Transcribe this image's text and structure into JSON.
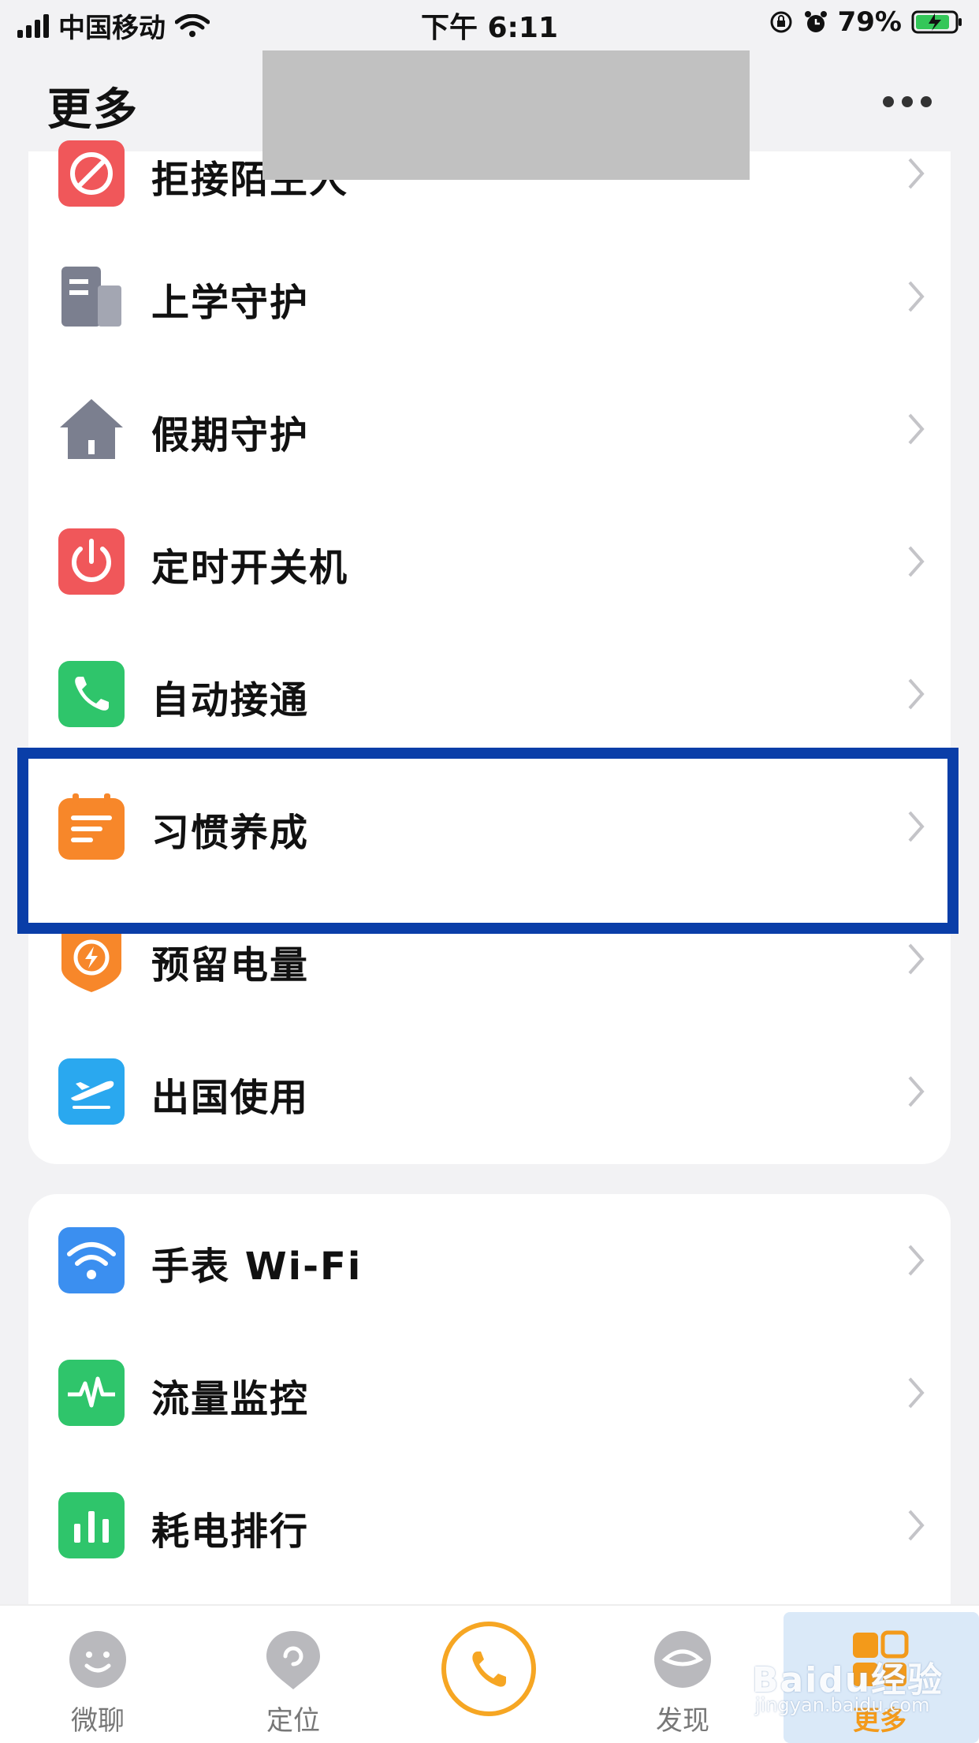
{
  "status_bar": {
    "carrier": "中国移动",
    "time": "下午 6:11",
    "battery": "79%"
  },
  "header": {
    "title": "更多"
  },
  "list_main": [
    {
      "label": "拒接陌生人",
      "icon": "reject-strangers-icon",
      "color": "#f0575a"
    },
    {
      "label": "上学守护",
      "icon": "school-building-icon",
      "color": "#7b7f8f"
    },
    {
      "label": "假期守护",
      "icon": "house-icon",
      "color": "#7b7f8f"
    },
    {
      "label": "定时开关机",
      "icon": "power-icon",
      "color": "#f0575a"
    },
    {
      "label": "自动接通",
      "icon": "phone-icon",
      "color": "#2fc56b"
    },
    {
      "label": "习惯养成",
      "icon": "habit-calendar-icon",
      "color": "#f7872a"
    },
    {
      "label": "预留电量",
      "icon": "battery-reserve-icon",
      "color": "#f7872a"
    },
    {
      "label": "出国使用",
      "icon": "airplane-icon",
      "color": "#2aa8ef"
    }
  ],
  "list_secondary": [
    {
      "label": "手表 Wi-Fi",
      "icon": "wifi-icon",
      "color": "#3b8ff0"
    },
    {
      "label": "流量监控",
      "icon": "traffic-monitor-icon",
      "color": "#2fc56b"
    },
    {
      "label": "耗电排行",
      "icon": "power-ranking-icon",
      "color": "#2fc56b"
    }
  ],
  "tabs": [
    {
      "label": "微聊",
      "icon": "chat-face-icon"
    },
    {
      "label": "定位",
      "icon": "location-pin-icon"
    },
    {
      "label": "",
      "icon": "call-icon"
    },
    {
      "label": "发现",
      "icon": "discover-eye-icon"
    },
    {
      "label": "更多",
      "icon": "more-grid-icon",
      "active": true
    }
  ],
  "watermark": {
    "text": "Baidu经验",
    "url": "jingyan.baidu.com"
  },
  "colors": {
    "accent": "#f39a1a",
    "highlight_border": "#0a3ea8"
  }
}
